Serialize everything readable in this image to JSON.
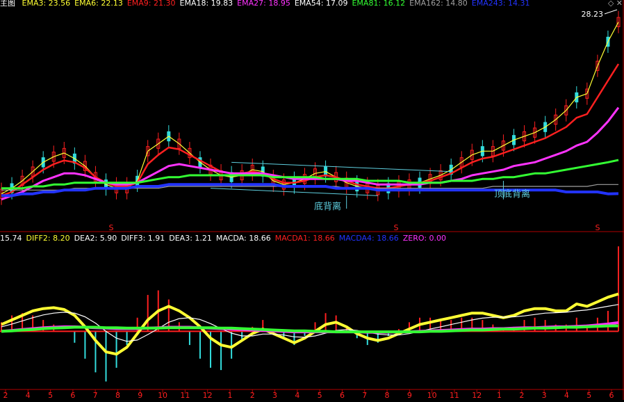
{
  "colors": {
    "background": "#000000",
    "border": "#b00000",
    "white": "#ffffff",
    "yellow": "#ffff33",
    "red": "#ff2020",
    "magenta": "#ff33ff",
    "green": "#33ff33",
    "gray": "#a0a0a0",
    "blue": "#2233ff",
    "cyan": "#33dddd",
    "annotation": "#5fd0e0"
  },
  "top_legend": {
    "panel_label": "主图",
    "items": [
      {
        "text": "EMA3: 23.56",
        "color": "#ffff33"
      },
      {
        "text": "EMA6: 22.13",
        "color": "#ffff33"
      },
      {
        "text": "EMA9: 21.30",
        "color": "#ff2020"
      },
      {
        "text": "EMA18: 19.83",
        "color": "#ffffff"
      },
      {
        "text": "EMA27: 18.95",
        "color": "#ff33ff"
      },
      {
        "text": "EMA54: 17.09",
        "color": "#ffffff"
      },
      {
        "text": "EMA81: 16.12",
        "color": "#33ff33"
      },
      {
        "text": "EMA162: 14.80",
        "color": "#a0a0a0"
      },
      {
        "text": "EMA243: 14.31",
        "color": "#2233ff"
      }
    ]
  },
  "sub_legend": {
    "items": [
      {
        "text": "15.74",
        "color": "#ffffff"
      },
      {
        "text": "DIFF2: 8.20",
        "color": "#ffff33"
      },
      {
        "text": "DEA2: 5.90",
        "color": "#ffffff"
      },
      {
        "text": "DIFF3: 1.91",
        "color": "#ffffff"
      },
      {
        "text": "DEA3: 1.21",
        "color": "#ffffff"
      },
      {
        "text": "MACDA: 18.66",
        "color": "#ffffff"
      },
      {
        "text": "MACDA1: 18.66",
        "color": "#ff2020"
      },
      {
        "text": "MACDA4: 18.66",
        "color": "#2233ff"
      },
      {
        "text": "ZERO: 0.00",
        "color": "#ff33ff"
      }
    ]
  },
  "annotations": {
    "bottom_divergence": "底背离",
    "top_bottom_divergence": "顶底背离",
    "high_price": "28.23",
    "marker": "S"
  },
  "chart_data": {
    "type": "line",
    "x_tick_labels": [
      "2",
      "4",
      "5",
      "6",
      "7",
      "8",
      "9",
      "10",
      "11",
      "12",
      "1",
      "2",
      "3",
      "4",
      "5",
      "6",
      "7",
      "8",
      "9",
      "10",
      "11",
      "12",
      "1",
      "2",
      "3",
      "4",
      "5",
      "6"
    ],
    "price_panel": {
      "high_label": "28.23",
      "series": [
        {
          "name": "EMA3",
          "color": "#ffff33",
          "values": [
            14.3,
            14.6,
            15.0,
            15.5,
            16.0,
            16.3,
            16.5,
            16.2,
            15.8,
            15.2,
            14.8,
            14.6,
            14.6,
            15.0,
            16.6,
            17.0,
            17.4,
            17.0,
            16.5,
            16.0,
            15.6,
            15.3,
            15.2,
            15.3,
            15.6,
            15.5,
            15.0,
            14.8,
            14.9,
            15.1,
            15.4,
            15.5,
            15.2,
            14.9,
            14.7,
            14.6,
            14.5,
            14.6,
            14.7,
            14.8,
            14.9,
            15.1,
            15.3,
            15.6,
            16.0,
            16.4,
            16.6,
            16.6,
            16.9,
            17.2,
            17.4,
            17.6,
            17.9,
            18.3,
            18.8,
            19.5,
            19.7,
            21.2,
            22.5,
            23.56
          ]
        },
        {
          "name": "EMA9",
          "color": "#ff2020",
          "values": [
            14.2,
            14.4,
            14.8,
            15.2,
            15.6,
            15.9,
            16.1,
            16.0,
            15.7,
            15.2,
            14.9,
            14.7,
            14.7,
            14.9,
            15.9,
            16.4,
            16.8,
            16.7,
            16.4,
            16.1,
            15.8,
            15.5,
            15.4,
            15.4,
            15.5,
            15.4,
            15.1,
            14.9,
            14.9,
            15.0,
            15.2,
            15.3,
            15.2,
            15.0,
            14.8,
            14.7,
            14.6,
            14.6,
            14.7,
            14.8,
            14.9,
            15.0,
            15.2,
            15.4,
            15.7,
            16.0,
            16.2,
            16.3,
            16.5,
            16.7,
            16.9,
            17.1,
            17.3,
            17.6,
            17.9,
            18.4,
            18.6,
            19.5,
            20.4,
            21.3
          ]
        },
        {
          "name": "EMA27",
          "color": "#ff33ff",
          "values": [
            14.0,
            14.2,
            14.4,
            14.7,
            15.0,
            15.2,
            15.4,
            15.4,
            15.3,
            15.1,
            14.9,
            14.8,
            14.8,
            14.9,
            15.2,
            15.5,
            15.8,
            15.9,
            15.8,
            15.7,
            15.6,
            15.5,
            15.4,
            15.4,
            15.4,
            15.4,
            15.3,
            15.2,
            15.1,
            15.1,
            15.1,
            15.1,
            15.1,
            15.0,
            15.0,
            14.9,
            14.8,
            14.8,
            14.8,
            14.8,
            14.8,
            14.9,
            14.9,
            15.0,
            15.1,
            15.3,
            15.4,
            15.5,
            15.6,
            15.8,
            15.9,
            16.0,
            16.2,
            16.4,
            16.6,
            16.9,
            17.1,
            17.6,
            18.2,
            18.95
          ]
        },
        {
          "name": "EMA81",
          "color": "#33ff33",
          "values": [
            14.6,
            14.6,
            14.6,
            14.7,
            14.7,
            14.8,
            14.8,
            14.9,
            14.9,
            14.9,
            14.9,
            14.9,
            14.9,
            14.9,
            15.0,
            15.1,
            15.2,
            15.2,
            15.3,
            15.3,
            15.3,
            15.3,
            15.3,
            15.3,
            15.3,
            15.3,
            15.2,
            15.2,
            15.2,
            15.2,
            15.2,
            15.1,
            15.1,
            15.1,
            15.1,
            15.0,
            15.0,
            15.0,
            15.0,
            14.9,
            14.9,
            14.9,
            14.9,
            15.0,
            15.0,
            15.0,
            15.1,
            15.1,
            15.2,
            15.2,
            15.3,
            15.4,
            15.4,
            15.5,
            15.6,
            15.7,
            15.8,
            15.9,
            16.0,
            16.12
          ]
        },
        {
          "name": "EMA162",
          "color": "#a0a0a0",
          "values": [
            14.5,
            14.5,
            14.5,
            14.5,
            14.5,
            14.5,
            14.5,
            14.6,
            14.6,
            14.6,
            14.6,
            14.6,
            14.6,
            14.6,
            14.6,
            14.6,
            14.7,
            14.7,
            14.7,
            14.7,
            14.7,
            14.7,
            14.7,
            14.7,
            14.7,
            14.7,
            14.7,
            14.7,
            14.7,
            14.7,
            14.7,
            14.7,
            14.7,
            14.6,
            14.6,
            14.6,
            14.6,
            14.6,
            14.6,
            14.6,
            14.6,
            14.6,
            14.6,
            14.6,
            14.6,
            14.6,
            14.6,
            14.7,
            14.7,
            14.7,
            14.7,
            14.7,
            14.7,
            14.7,
            14.7,
            14.7,
            14.7,
            14.8,
            14.8,
            14.8
          ]
        },
        {
          "name": "EMA243",
          "color": "#2233ff",
          "values": [
            14.2,
            14.2,
            14.3,
            14.3,
            14.4,
            14.4,
            14.5,
            14.5,
            14.5,
            14.6,
            14.6,
            14.6,
            14.6,
            14.7,
            14.7,
            14.7,
            14.8,
            14.8,
            14.8,
            14.8,
            14.8,
            14.8,
            14.8,
            14.8,
            14.8,
            14.8,
            14.8,
            14.7,
            14.7,
            14.7,
            14.7,
            14.7,
            14.6,
            14.6,
            14.6,
            14.6,
            14.5,
            14.5,
            14.5,
            14.5,
            14.5,
            14.5,
            14.5,
            14.5,
            14.5,
            14.5,
            14.5,
            14.5,
            14.5,
            14.5,
            14.5,
            14.5,
            14.5,
            14.5,
            14.4,
            14.4,
            14.4,
            14.4,
            14.3,
            14.31
          ]
        }
      ]
    },
    "indicator_panel": {
      "series": [
        {
          "name": "DIFF2",
          "color": "#ffff33",
          "values": [
            1.5,
            2.5,
            3.5,
            4.5,
            5.0,
            5.2,
            4.8,
            3.5,
            1.0,
            -2.0,
            -4.5,
            -5.0,
            -3.5,
            -0.5,
            2.5,
            4.5,
            5.5,
            4.5,
            3.0,
            1.0,
            -1.5,
            -3.0,
            -3.5,
            -2.0,
            -0.5,
            0.5,
            -0.5,
            -1.5,
            -2.5,
            -1.5,
            0.0,
            1.5,
            2.0,
            1.0,
            -0.5,
            -1.5,
            -2.0,
            -1.5,
            -0.5,
            0.5,
            1.5,
            2.0,
            2.5,
            3.0,
            3.5,
            4.0,
            4.0,
            3.5,
            3.0,
            3.5,
            4.5,
            5.0,
            5.0,
            4.5,
            4.5,
            6.0,
            5.5,
            6.5,
            7.5,
            8.2
          ]
        },
        {
          "name": "DEA2",
          "color": "#ffffff",
          "values": [
            1.0,
            1.6,
            2.3,
            3.0,
            3.6,
            4.0,
            4.2,
            4.0,
            3.2,
            1.8,
            0.0,
            -1.5,
            -2.2,
            -1.9,
            -0.7,
            0.6,
            2.0,
            2.8,
            3.0,
            2.6,
            1.7,
            0.6,
            -0.4,
            -1.0,
            -1.0,
            -0.6,
            -0.6,
            -0.8,
            -1.2,
            -1.3,
            -1.0,
            -0.4,
            0.2,
            0.4,
            0.2,
            -0.2,
            -0.6,
            -0.8,
            -0.8,
            -0.5,
            0.0,
            0.5,
            1.0,
            1.5,
            2.0,
            2.5,
            2.9,
            3.1,
            3.1,
            3.2,
            3.4,
            3.7,
            4.0,
            4.1,
            4.2,
            4.5,
            4.7,
            5.1,
            5.5,
            5.9
          ]
        },
        {
          "name": "DIFF3",
          "color": "#ff33ff",
          "values": [
            0.0,
            0.2,
            0.4,
            0.6,
            0.8,
            0.9,
            1.0,
            1.0,
            0.9,
            0.8,
            0.7,
            0.6,
            0.6,
            0.6,
            0.7,
            0.8,
            0.9,
            0.9,
            0.9,
            0.8,
            0.7,
            0.6,
            0.5,
            0.4,
            0.3,
            0.2,
            0.1,
            0.0,
            -0.1,
            -0.1,
            -0.1,
            -0.1,
            -0.1,
            -0.1,
            -0.1,
            -0.2,
            -0.2,
            -0.2,
            -0.1,
            -0.1,
            0.0,
            0.1,
            0.2,
            0.3,
            0.4,
            0.5,
            0.5,
            0.6,
            0.6,
            0.7,
            0.8,
            0.8,
            0.9,
            1.0,
            1.0,
            1.1,
            1.2,
            1.4,
            1.6,
            1.91
          ]
        },
        {
          "name": "DEA3",
          "color": "#33ff33",
          "values": [
            0.0,
            0.1,
            0.3,
            0.4,
            0.6,
            0.7,
            0.8,
            0.9,
            0.9,
            0.9,
            0.8,
            0.8,
            0.7,
            0.7,
            0.7,
            0.7,
            0.8,
            0.8,
            0.8,
            0.8,
            0.8,
            0.7,
            0.7,
            0.6,
            0.5,
            0.4,
            0.3,
            0.2,
            0.1,
            0.1,
            0.0,
            0.0,
            -0.1,
            -0.1,
            -0.1,
            -0.1,
            -0.1,
            -0.1,
            -0.1,
            -0.1,
            -0.1,
            0.0,
            0.0,
            0.1,
            0.2,
            0.3,
            0.3,
            0.4,
            0.5,
            0.5,
            0.6,
            0.7,
            0.7,
            0.8,
            0.9,
            0.9,
            1.0,
            1.1,
            1.2,
            1.21
          ]
        },
        {
          "name": "MACDA",
          "color": "#ff2020",
          "bars": true,
          "values": [
            2.0,
            3.5,
            4.0,
            3.5,
            2.5,
            1.5,
            0.0,
            -2.5,
            -6.0,
            -9.0,
            -11.0,
            -8.0,
            -3.0,
            3.0,
            8.0,
            9.0,
            7.0,
            2.0,
            -3.0,
            -6.0,
            -8.0,
            -8.5,
            -6.0,
            -2.0,
            1.0,
            2.5,
            0.5,
            -1.5,
            -3.0,
            -1.0,
            2.0,
            4.0,
            3.5,
            1.0,
            -1.5,
            -3.0,
            -2.5,
            -1.0,
            0.5,
            2.0,
            3.0,
            3.0,
            2.5,
            2.5,
            3.0,
            3.0,
            2.5,
            1.5,
            0.5,
            1.0,
            2.5,
            3.0,
            2.5,
            1.5,
            1.5,
            3.0,
            1.5,
            3.0,
            4.5,
            18.66
          ]
        }
      ]
    }
  }
}
